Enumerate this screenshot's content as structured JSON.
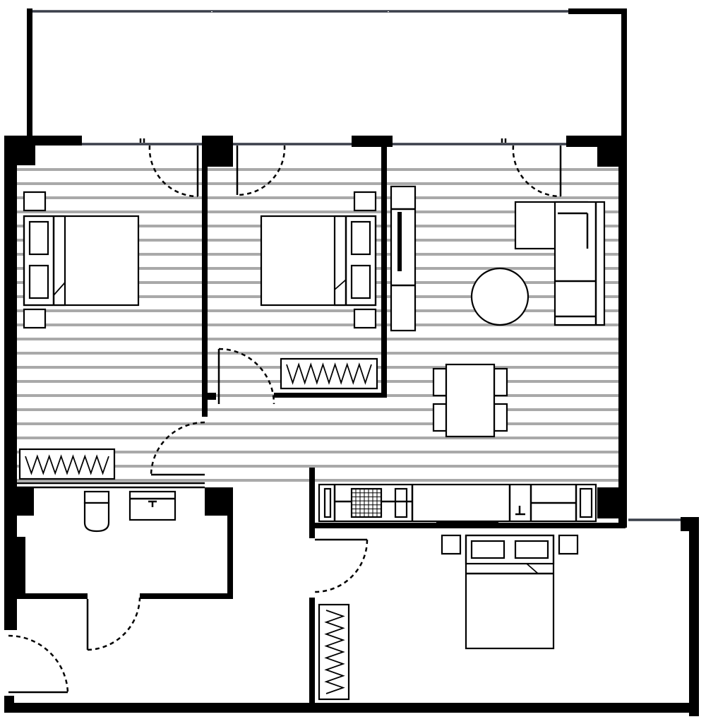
{
  "floor_plan": {
    "rooms": [
      {
        "id": "bedroom-west",
        "furniture": [
          "double-bed",
          "nightstand",
          "nightstand",
          "wardrobe"
        ]
      },
      {
        "id": "bedroom-middle",
        "furniture": [
          "double-bed",
          "nightstand",
          "nightstand",
          "wardrobe"
        ]
      },
      {
        "id": "living-room",
        "furniture": [
          "tv-unit",
          "corner-sofa",
          "round-coffee-table",
          "dining-table",
          "chair",
          "chair",
          "chair",
          "chair"
        ]
      },
      {
        "id": "kitchen",
        "furniture": [
          "kitchen-counter",
          "sink",
          "cooktop",
          "fridge"
        ]
      },
      {
        "id": "bathroom",
        "furniture": [
          "toilet",
          "washbasin"
        ]
      },
      {
        "id": "bedroom-south",
        "furniture": [
          "double-bed",
          "nightstand",
          "nightstand",
          "wardrobe"
        ]
      },
      {
        "id": "balcony",
        "furniture": []
      },
      {
        "id": "entrance-hall",
        "furniture": []
      }
    ],
    "colors": {
      "wall": "#000000",
      "glazing": "#3a3f4a",
      "floor_hatch": "#a9a9a9",
      "background": "#ffffff"
    }
  }
}
